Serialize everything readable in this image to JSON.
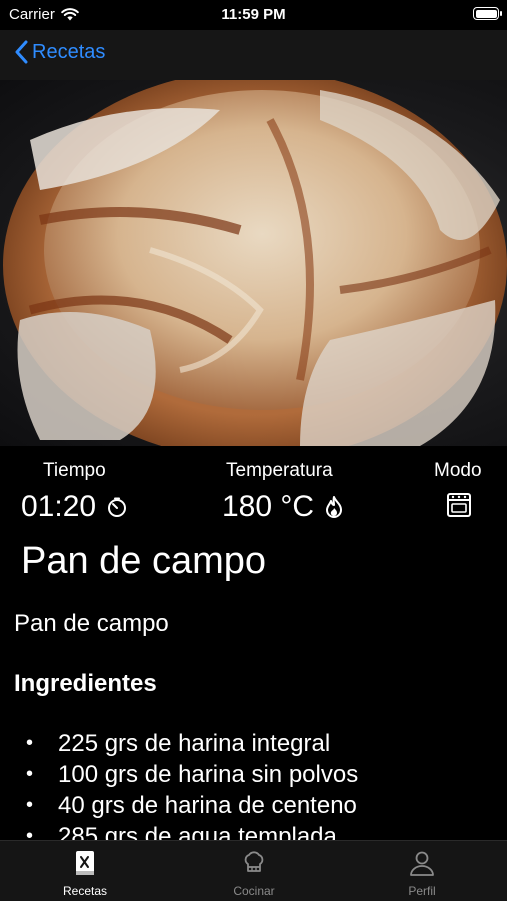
{
  "status_bar": {
    "carrier": "Carrier",
    "time": "11:59 PM"
  },
  "nav": {
    "back_label": "Recetas"
  },
  "stats": {
    "time_label": "Tiempo",
    "time_value": "01:20",
    "temp_label": "Temperatura",
    "temp_value": "180 °C",
    "mode_label": "Modo"
  },
  "recipe": {
    "title": "Pan de campo",
    "subtitle": "Pan de campo",
    "ingredients_heading": "Ingredientes",
    "ingredients": [
      "225 grs de harina integral",
      "100 grs de harina sin polvos",
      "40 grs de harina de centeno",
      "285 grs de agua templada"
    ]
  },
  "tabs": [
    {
      "label": "Recetas"
    },
    {
      "label": "Cocinar"
    },
    {
      "label": "Perfil"
    }
  ],
  "colors": {
    "accent": "#2f8cff",
    "active_tab": "#ffffff",
    "inactive_tab": "#8a8a8a"
  }
}
